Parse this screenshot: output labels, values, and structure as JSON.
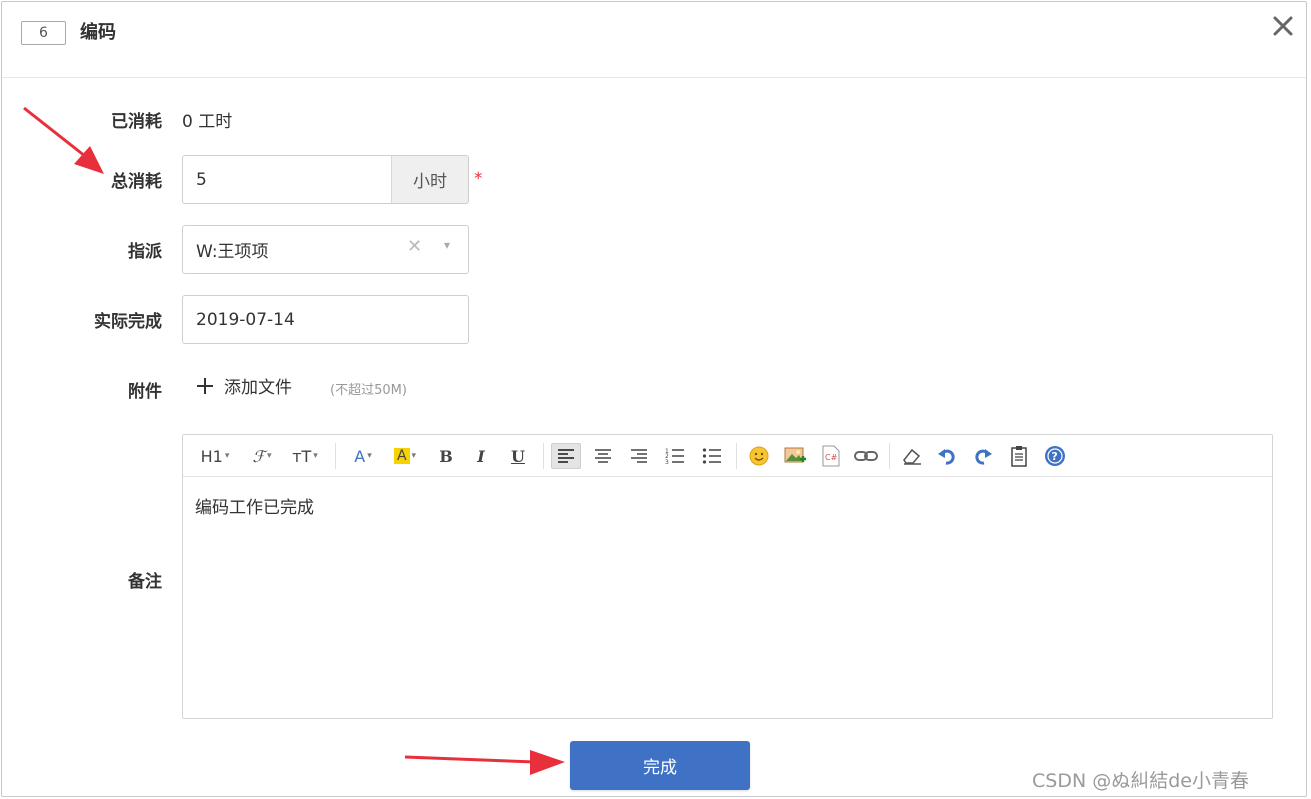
{
  "header": {
    "id": "6",
    "title": "编码"
  },
  "form": {
    "consumed": {
      "label": "已消耗",
      "value": "0 工时"
    },
    "total": {
      "label": "总消耗",
      "value": "5",
      "unit": "小时",
      "required_mark": "*"
    },
    "assign": {
      "label": "指派",
      "value": "W:王项项",
      "clear": "✕",
      "caret": "▾"
    },
    "finished_date": {
      "label": "实际完成",
      "value": "2019-07-14"
    },
    "attachment": {
      "label": "附件",
      "add_label": "添加文件",
      "hint": "(不超过50M)"
    },
    "remark": {
      "label": "备注",
      "content": "编码工作已完成"
    }
  },
  "toolbar": {
    "heading": "H1",
    "font_family": "ℱ",
    "font_size": "ᴛT",
    "font_color": "A",
    "bg_color": "A",
    "bold": "B",
    "italic": "I",
    "underline": "U"
  },
  "submit": {
    "label": "完成"
  },
  "watermark": "CSDN @ぬ糾結de小青春",
  "colors": {
    "primary": "#3f72c4",
    "required": "#e0373f",
    "arrow": "#e8303c"
  }
}
